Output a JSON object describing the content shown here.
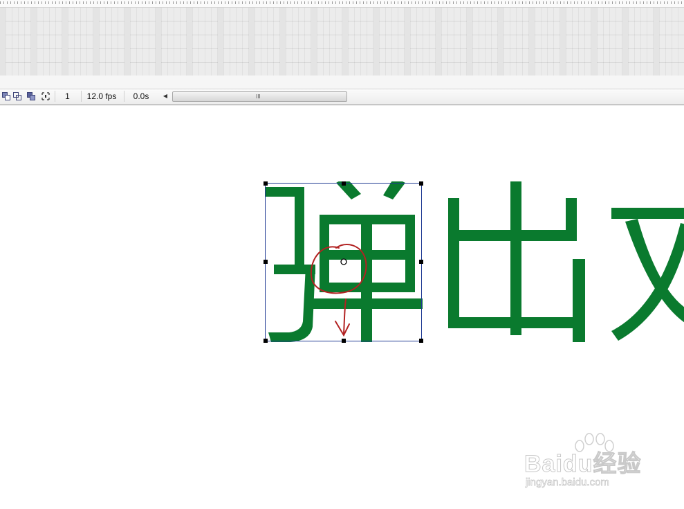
{
  "timeline": {
    "frame_number": "1",
    "frame_rate": "12.0 fps",
    "elapsed_time": "0.0s",
    "scroll_grip_glyph": "III"
  },
  "icons": {
    "onion_skin": "onion-skin-icon",
    "onion_skin_outlines": "onion-skin-outlines-icon",
    "edit_multiple_frames": "edit-multiple-frames-icon",
    "modify_markers": "modify-onion-markers-icon",
    "scroll_left": "scroll-left-arrow-icon"
  },
  "stage": {
    "text_chars": [
      "弹",
      "出",
      "文"
    ],
    "text_color": "#0a7a2e",
    "annotation_color": "#b22222",
    "selection_color": "#1f3a93"
  },
  "watermark": {
    "brand": "Baidu经验",
    "url": "jingyan.baidu.com"
  }
}
